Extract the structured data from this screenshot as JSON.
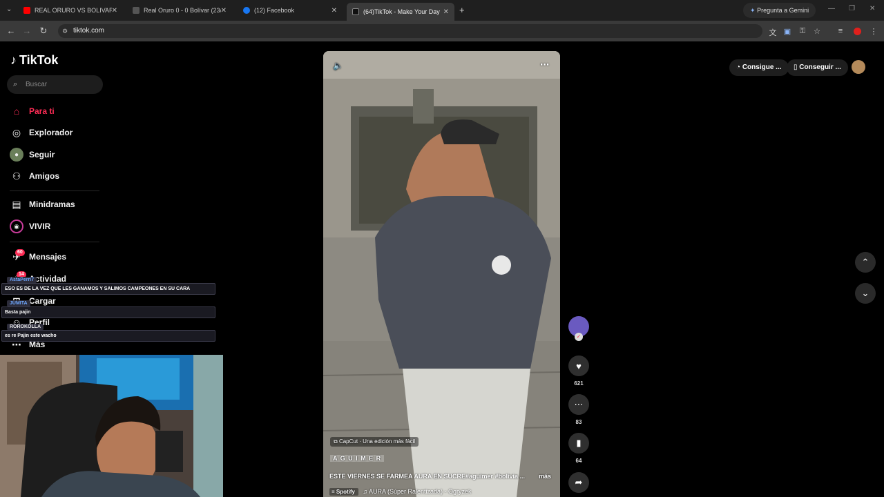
{
  "browser": {
    "tabs": [
      {
        "title": "REAL ORURO VS BOLIVAR RESU",
        "favicon": "#ff0000",
        "active": false
      },
      {
        "title": "Real Oruro 0 - 0 Bolívar (23/8)",
        "favicon": "#3a3a3a",
        "active": false
      },
      {
        "title": "(12) Facebook",
        "favicon": "#1877f2",
        "active": false
      },
      {
        "title": "(64)TikTok - Make Your Day",
        "favicon": "#111111",
        "active": true
      }
    ],
    "new_tab": "+",
    "gemini_label": "Pregunta a Gemini",
    "url": "tiktok.com"
  },
  "sidebar": {
    "logo": "TikTok",
    "search_placeholder": "Buscar",
    "items": [
      {
        "label": "Para ti",
        "icon": "home-icon"
      },
      {
        "label": "Explorador",
        "icon": "compass-icon"
      },
      {
        "label": "Seguir",
        "icon": "following-icon"
      },
      {
        "label": "Amigos",
        "icon": "friends-icon"
      },
      {
        "label": "Minidramas",
        "icon": "film-icon"
      },
      {
        "label": "VIVIR",
        "icon": "live-icon"
      },
      {
        "label": "Mensajes",
        "icon": "messages-icon",
        "badge": "60"
      },
      {
        "label": "Actividad",
        "icon": "activity-icon",
        "badge": "14"
      },
      {
        "label": "Cargar",
        "icon": "upload-icon"
      },
      {
        "label": "Perfil",
        "icon": "profile-icon"
      },
      {
        "label": "Más",
        "icon": "more-icon"
      }
    ]
  },
  "chat": [
    {
      "user": "AstaPerri7",
      "message": "ESO ES DE LA VEZ QUE LES GANAMOS Y SALIMOS CAMPEONES EN SU CARA"
    },
    {
      "user": "JUMITA",
      "message": "Basta pajin"
    },
    {
      "user": "ROROKOLLA",
      "message": "es re Pajin este wacho"
    }
  ],
  "video": {
    "capcut_label": "CapCut · Una edición más fácil",
    "author_tag": "A G U I M E R",
    "caption": "ESTE VIERNES SE FARMEA AURA EN SUCRE#aguimer #bolivia ...",
    "more_label": "más",
    "spotify_label": "Spotify",
    "music": "AURA (Súper Ralentizada) - Ogryzek"
  },
  "actions": {
    "likes": "621",
    "comments": "83",
    "saves": "64"
  },
  "top_right": {
    "btn1": "Consigue ...",
    "btn2": "Conseguir ..."
  }
}
